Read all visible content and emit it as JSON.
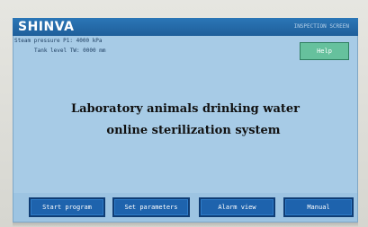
{
  "header": {
    "logo_text": "SHINVA",
    "right_label": "INSPECTION SCREEN"
  },
  "status": {
    "steam_pressure": "Steam pressure P1: 4000 kPa",
    "tank_level": "Tank level TW: 0000 mm"
  },
  "help_button": "Help",
  "title": {
    "line1": "Laboratory animals drinking water",
    "line2": "online sterilization system"
  },
  "buttons": [
    {
      "label": "Start program"
    },
    {
      "label": "Set parameters"
    },
    {
      "label": "Alarm view"
    },
    {
      "label": "Manual"
    }
  ],
  "colors": {
    "screen_bg": "#a7cbe6",
    "topbar": "#1f5f9a",
    "button": "#1e63ad",
    "help": "#66c19d"
  }
}
